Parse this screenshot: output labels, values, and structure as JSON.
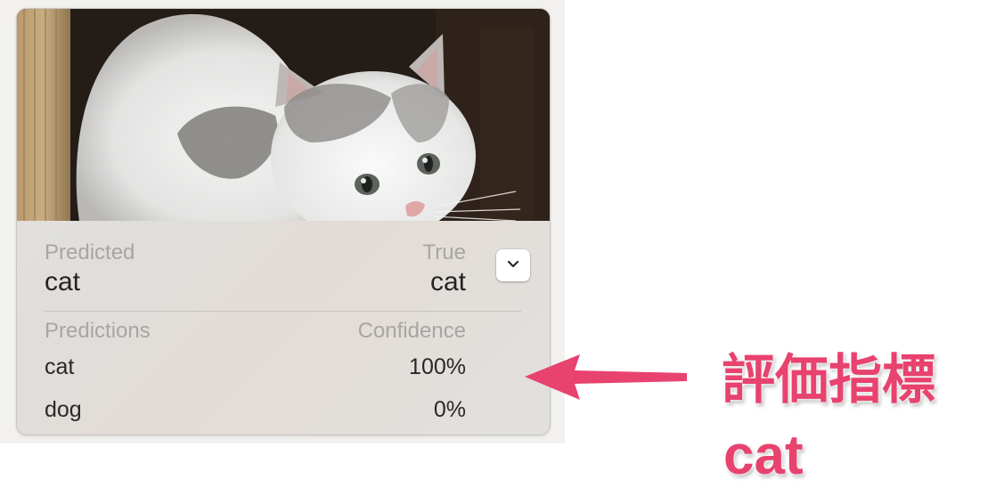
{
  "card": {
    "image_alt": "kitten photo",
    "predicted_label": "Predicted",
    "predicted_value": "cat",
    "true_label": "True",
    "true_value": "cat",
    "menu_icon": "chevron-down-icon",
    "predictions_header": "Predictions",
    "confidence_header": "Confidence",
    "rows": [
      {
        "prediction": "cat",
        "confidence": "100%"
      },
      {
        "prediction": "dog",
        "confidence": "0%"
      }
    ]
  },
  "annotation": {
    "title": "評価指標",
    "value": "cat",
    "color": "#e8426f",
    "arrow_icon": "left-arrow-icon"
  }
}
